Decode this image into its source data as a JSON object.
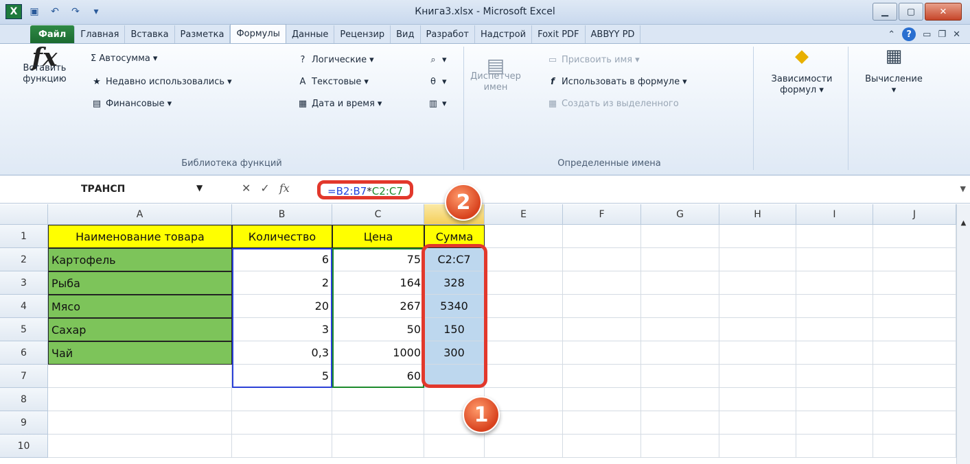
{
  "app": {
    "title": "Книга3.xlsx - Microsoft Excel",
    "logo": "X"
  },
  "tabs": [
    "Файл",
    "Главная",
    "Вставка",
    "Разметка",
    "Формулы",
    "Данные",
    "Рецензир",
    "Вид",
    "Разработ",
    "Надстрой",
    "Foxit PDF",
    "ABBYY PD"
  ],
  "active_tab": "Формулы",
  "ribbon": {
    "insert_function": {
      "line1": "Вставить",
      "line2": "функцию",
      "icon": "fx-icon",
      "glyph": "fx"
    },
    "function_library": {
      "label": "Библиотека функций",
      "autosum": "Σ Автосумма",
      "recent": "Недавно использовались",
      "financial": "Финансовые",
      "logical": "Логические",
      "text": "Текстовые",
      "datetime": "Дата и время"
    },
    "defined_names": {
      "label": "Определенные имена",
      "name_manager_line1": "Диспетчер",
      "name_manager_line2": "имен",
      "define_name": "Присвоить имя",
      "use_in_formula": "Использовать в формуле",
      "create_from_selection": "Создать из выделенного"
    },
    "dependencies": {
      "line1": "Зависимости",
      "line2": "формул"
    },
    "calculation": {
      "line1": "Вычисление"
    }
  },
  "formula_bar": {
    "name_box": "ТРАНСП",
    "formula_p1": "=B2:B7",
    "formula_p2": "*",
    "formula_p3": "C2:C7",
    "cancel": "✕",
    "enter": "✓",
    "fx": "fx"
  },
  "columns": [
    "A",
    "B",
    "C",
    "D",
    "E",
    "F",
    "G",
    "H",
    "I",
    "J"
  ],
  "rows": [
    "1",
    "2",
    "3",
    "4",
    "5",
    "6",
    "7",
    "8",
    "9",
    "10"
  ],
  "table": {
    "headers": [
      "Наименование товара",
      "Количество",
      "Цена",
      "Сумма"
    ],
    "items": [
      {
        "name": "Картофель",
        "qty": "6",
        "price": "75",
        "sum": "C2:C7"
      },
      {
        "name": "Рыба",
        "qty": "2",
        "price": "164",
        "sum": "328"
      },
      {
        "name": "Мясо",
        "qty": "20",
        "price": "267",
        "sum": "5340"
      },
      {
        "name": "Сахар",
        "qty": "3",
        "price": "50",
        "sum": "150"
      },
      {
        "name": "Чай",
        "qty": "0,3",
        "price": "1000",
        "sum": "300"
      },
      {
        "name": "",
        "qty": "5",
        "price": "60",
        "sum": ""
      }
    ]
  },
  "callouts": {
    "one": "1",
    "two": "2"
  },
  "colors": {
    "yellow": "#ffff00",
    "green": "#7dc45a",
    "blue_fill": "#bdd7ee",
    "callout_red": "#e2382c"
  }
}
